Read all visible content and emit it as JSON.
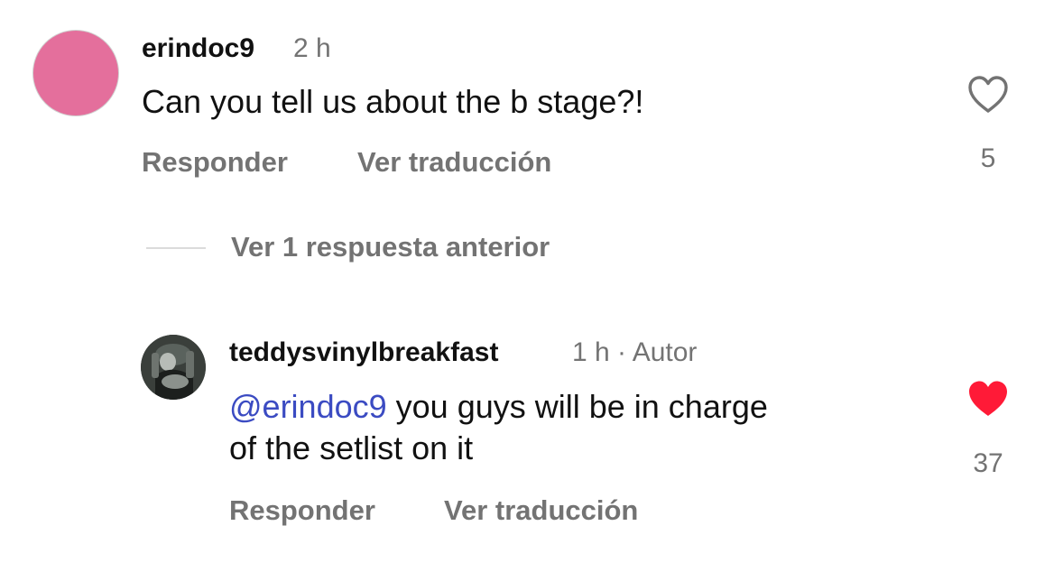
{
  "comments": [
    {
      "username": "erindoc9",
      "time": "2 h",
      "text": "Can you tell us about the b stage?!",
      "reply_label": "Responder",
      "translate_label": "Ver traducción",
      "likes": "5",
      "liked": false,
      "avatar_color": "#e46f9c"
    },
    {
      "username": "teddysvinylbreakfast",
      "time": "1 h · Autor",
      "mention": "@erindoc9",
      "text_line1": " you guys will be in charge",
      "text_line2": "of the setlist on it",
      "reply_label": "Responder",
      "translate_label": "Ver traducción",
      "likes": "37",
      "liked": true
    }
  ],
  "view_replies_label": "Ver 1 respuesta anterior",
  "colors": {
    "mention": "#3b4bc2",
    "heart_liked": "#ff1a37",
    "muted": "#737373"
  },
  "icons": {
    "like_empty": "heart-outline-icon",
    "like_filled": "heart-filled-icon"
  }
}
